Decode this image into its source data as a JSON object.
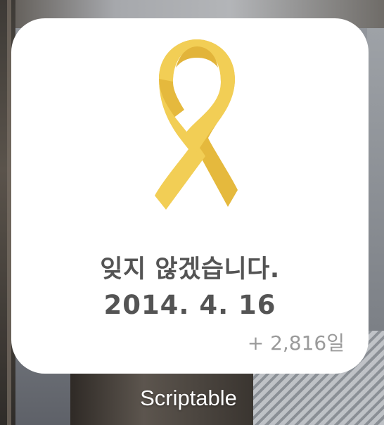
{
  "widget": {
    "icon": "yellow-ribbon-icon",
    "message": "잊지 않겠습니다.",
    "date": "2014. 4. 16",
    "days_since": "+ 2,816일"
  },
  "app": {
    "label": "Scriptable"
  },
  "colors": {
    "ribbon": "#F2CE55",
    "ribbon_shadow": "#E5B93D",
    "text": "#545454",
    "secondary_text": "#9A9A9A",
    "widget_bg": "#FFFFFF"
  }
}
